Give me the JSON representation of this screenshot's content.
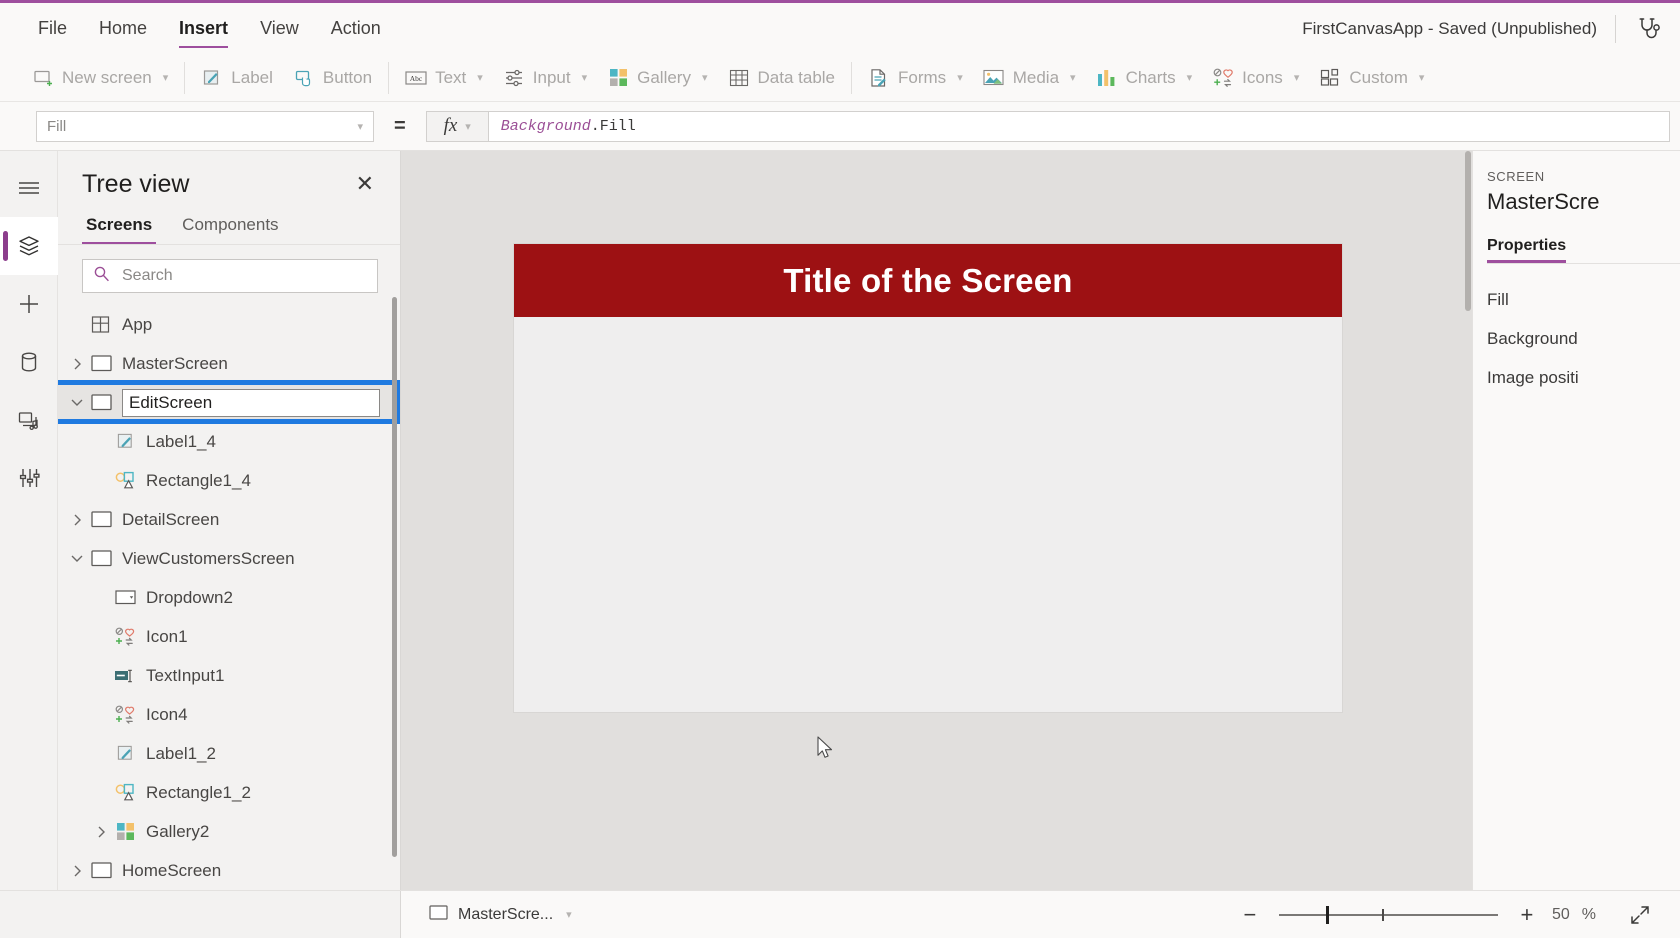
{
  "menubar": {
    "items": [
      {
        "label": "File",
        "active": false
      },
      {
        "label": "Home",
        "active": false
      },
      {
        "label": "Insert",
        "active": true
      },
      {
        "label": "View",
        "active": false
      },
      {
        "label": "Action",
        "active": false
      }
    ],
    "app_status": "FirstCanvasApp - Saved (Unpublished)",
    "app_checker_icon": "stethoscope-icon"
  },
  "ribbon": {
    "items": [
      {
        "label": "New screen",
        "icon": "new-screen-icon",
        "caret": true
      },
      {
        "label": "Label",
        "icon": "label-icon",
        "caret": false
      },
      {
        "label": "Button",
        "icon": "button-icon",
        "caret": false
      },
      {
        "label": "Text",
        "icon": "text-abc-icon",
        "caret": true
      },
      {
        "label": "Input",
        "icon": "input-sliders-icon",
        "caret": true
      },
      {
        "label": "Gallery",
        "icon": "gallery-grid-icon",
        "caret": true
      },
      {
        "label": "Data table",
        "icon": "data-table-icon",
        "caret": false
      },
      {
        "label": "Forms",
        "icon": "forms-icon",
        "caret": true
      },
      {
        "label": "Media",
        "icon": "media-image-icon",
        "caret": true
      },
      {
        "label": "Charts",
        "icon": "charts-bar-icon",
        "caret": true
      },
      {
        "label": "Icons",
        "icon": "icons-shapes-icon",
        "caret": true
      },
      {
        "label": "Custom",
        "icon": "custom-blocks-icon",
        "caret": true
      }
    ]
  },
  "formula_bar": {
    "property_value": "Fill",
    "equals": "=",
    "fx_label": "fx",
    "formula_identifier": "Background",
    "formula_rest": ".Fill"
  },
  "rail": {
    "items": [
      {
        "name": "hamburger-menu-icon",
        "selected": false
      },
      {
        "name": "tree-view-layers-icon",
        "selected": true
      },
      {
        "name": "insert-plus-icon",
        "selected": false
      },
      {
        "name": "data-cylinder-icon",
        "selected": false
      },
      {
        "name": "media-icon",
        "selected": false
      },
      {
        "name": "advanced-tools-icon",
        "selected": false
      }
    ]
  },
  "tree_panel": {
    "title": "Tree view",
    "close_label": "✕",
    "tabs": [
      {
        "label": "Screens",
        "active": true
      },
      {
        "label": "Components",
        "active": false
      }
    ],
    "search_placeholder": "Search",
    "search_value": "",
    "nodes": [
      {
        "label": "App",
        "icon": "app-icon",
        "indent": 0,
        "twisty": "",
        "editing": false
      },
      {
        "label": "MasterScreen",
        "icon": "screen-icon",
        "indent": 0,
        "twisty": "right",
        "editing": false
      },
      {
        "label": "EditScreen",
        "icon": "screen-icon",
        "indent": 0,
        "twisty": "down",
        "editing": true
      },
      {
        "label": "Label1_4",
        "icon": "label-icon",
        "indent": 1,
        "twisty": "",
        "editing": false
      },
      {
        "label": "Rectangle1_4",
        "icon": "shape-icon",
        "indent": 1,
        "twisty": "",
        "editing": false
      },
      {
        "label": "DetailScreen",
        "icon": "screen-icon",
        "indent": 0,
        "twisty": "right",
        "editing": false
      },
      {
        "label": "ViewCustomersScreen",
        "icon": "screen-icon",
        "indent": 0,
        "twisty": "down",
        "editing": false
      },
      {
        "label": "Dropdown2",
        "icon": "dropdown-icon",
        "indent": 1,
        "twisty": "",
        "editing": false
      },
      {
        "label": "Icon1",
        "icon": "icons-shapes-icon",
        "indent": 1,
        "twisty": "",
        "editing": false
      },
      {
        "label": "TextInput1",
        "icon": "text-input-icon",
        "indent": 1,
        "twisty": "",
        "editing": false
      },
      {
        "label": "Icon4",
        "icon": "icons-shapes-icon",
        "indent": 1,
        "twisty": "",
        "editing": false
      },
      {
        "label": "Label1_2",
        "icon": "label-icon",
        "indent": 1,
        "twisty": "",
        "editing": false
      },
      {
        "label": "Rectangle1_2",
        "icon": "shape-icon",
        "indent": 1,
        "twisty": "",
        "editing": false
      },
      {
        "label": "Gallery2",
        "icon": "gallery-grid-icon",
        "indent": 1,
        "twisty": "right",
        "editing": false
      },
      {
        "label": "HomeScreen",
        "icon": "screen-icon",
        "indent": 0,
        "twisty": "right",
        "editing": false
      }
    ]
  },
  "canvas": {
    "screen_title": "Title of the Screen",
    "title_bar_color": "#9d1113",
    "screen_body_color": "#efeeee",
    "backdrop_color": "#e1dfdd"
  },
  "right_panel": {
    "kicker": "SCREEN",
    "name": "MasterScre",
    "tabs": [
      {
        "label": "Properties",
        "active": true
      }
    ],
    "properties": [
      {
        "label": "Fill"
      },
      {
        "label": "Background"
      },
      {
        "label": "Image positi"
      }
    ]
  },
  "statusbar": {
    "screen_selector_label": "MasterScre...",
    "screen_selector_icon": "screen-icon",
    "zoom_minus": "−",
    "zoom_plus": "+",
    "zoom_value": "50",
    "zoom_unit": "%",
    "expand_icon": "expand-diagonal-icon"
  },
  "colors": {
    "accent_purple": "#9e4f9e",
    "selection_blue": "#1f7ae0",
    "title_red": "#9d1113"
  }
}
